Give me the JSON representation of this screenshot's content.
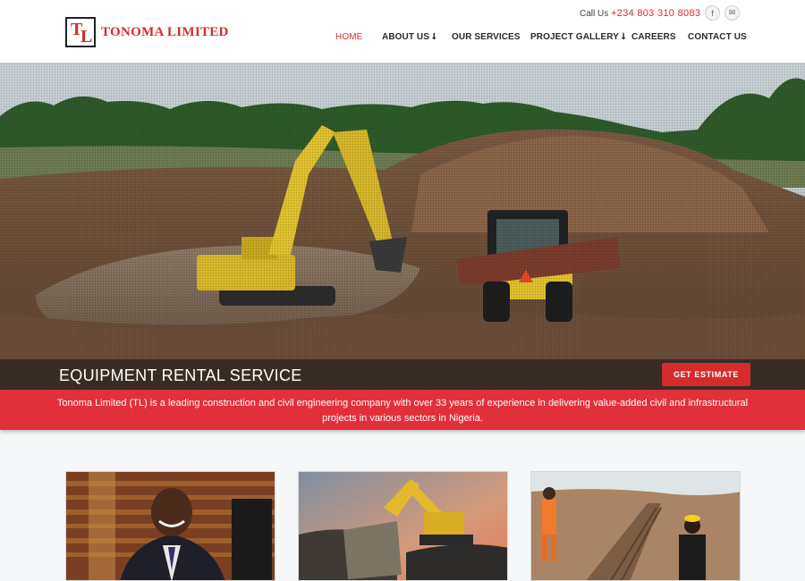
{
  "brand": {
    "logo_mark_t": "T",
    "logo_mark_l": "L",
    "name": "TONOMA LIMITED"
  },
  "contact": {
    "call_label": "Call Us",
    "phone": "+234 803 310 8083"
  },
  "social": [
    {
      "icon": "facebook-icon",
      "glyph": "f"
    },
    {
      "icon": "mail-icon",
      "glyph": "✉"
    }
  ],
  "nav": {
    "items": [
      {
        "label": "HOME",
        "active": true
      },
      {
        "label": "ABOUT US ⭣",
        "active": false
      },
      {
        "label": "OUR SERVICES",
        "active": false
      },
      {
        "label": "PROJECT GALLERY ⭣",
        "active": false
      },
      {
        "label": "CAREERS",
        "active": false
      },
      {
        "label": "CONTACT US",
        "active": false
      }
    ]
  },
  "hero": {
    "title": "EQUIPMENT RENTAL SERVICE",
    "cta_label": "GET ESTIMATE"
  },
  "intro": {
    "text": "Tonoma Limited (TL) is a leading construction and civil engineering company with over 33 years of experience in delivering value-added civil and infrastructural projects in various sectors in Nigeria."
  },
  "colors": {
    "brand_red": "#d62b2b",
    "strip_red": "#e2303a",
    "header_bg": "#ffffff"
  }
}
